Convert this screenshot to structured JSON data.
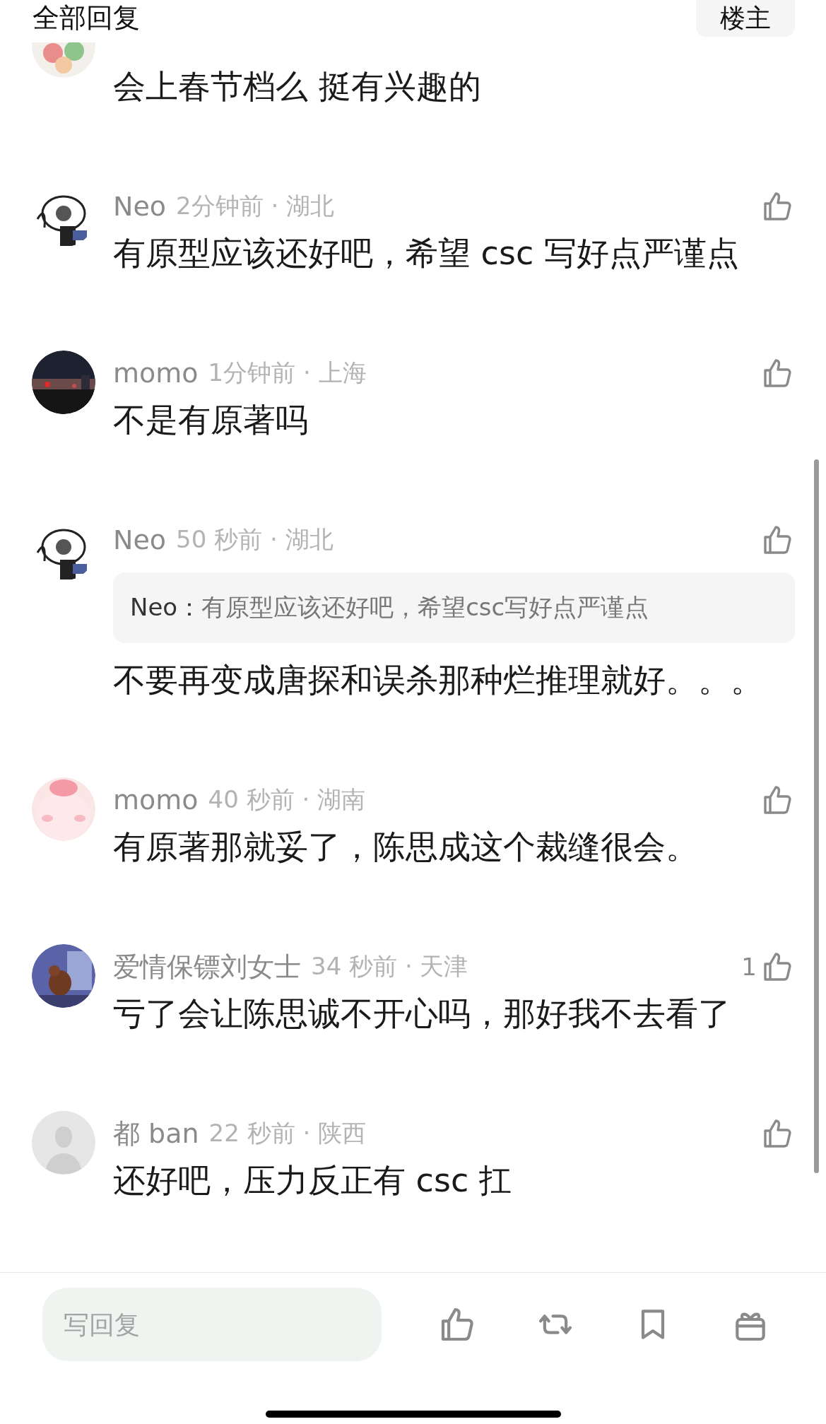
{
  "header": {
    "title": "全部回复",
    "button": "楼主"
  },
  "comments": [
    {
      "text": "会上春节档么 挺有兴趣的"
    },
    {
      "author": "Neo",
      "meta": "2分钟前 · 湖北",
      "text": "有原型应该还好吧，希望 csc 写好点严谨点"
    },
    {
      "author": "momo",
      "meta": "1分钟前 · 上海",
      "text": "不是有原著吗"
    },
    {
      "author": "Neo",
      "meta": "50 秒前 · 湖北",
      "quote": {
        "author": "Neo：",
        "text": "有原型应该还好吧，希望csc写好点严谨点"
      },
      "text": "不要再变成唐探和误杀那种烂推理就好。。。"
    },
    {
      "author": "momo",
      "meta": "40 秒前 · 湖南",
      "text": "有原著那就妥了，陈思成这个裁缝很会。"
    },
    {
      "author": "爱情保镖刘女士",
      "meta": "34 秒前 · 天津",
      "likes": "1",
      "text": "亏了会让陈思诚不开心吗，那好我不去看了"
    },
    {
      "avatar": {
        "kind": "default"
      },
      "author": "都 ban",
      "meta": "22 秒前 · 陕西",
      "text": "还好吧，压力反正有 csc 扛"
    }
  ],
  "reply_bar": {
    "placeholder": "写回复"
  }
}
